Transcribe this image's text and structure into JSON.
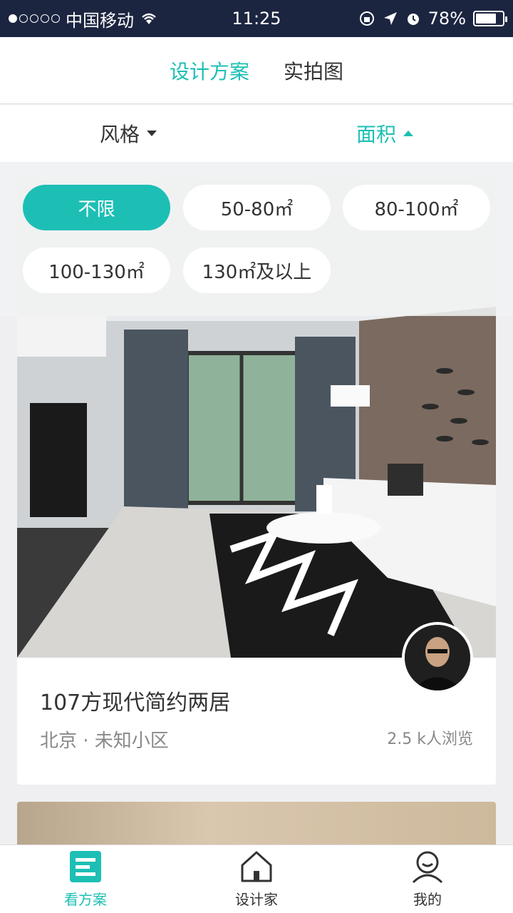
{
  "statusbar": {
    "carrier": "中国移动",
    "time": "11:25",
    "battery": "78%",
    "battery_level": 0.78
  },
  "tabs": [
    {
      "label": "设计方案",
      "active": true
    },
    {
      "label": "实拍图",
      "active": false
    }
  ],
  "filters": {
    "style": "风格",
    "area": "面积"
  },
  "area_options": [
    {
      "label": "不限",
      "active": true
    },
    {
      "label": "50-80㎡",
      "active": false
    },
    {
      "label": "80-100㎡",
      "active": false
    },
    {
      "label": "100-130㎡",
      "active": false
    },
    {
      "label": "130㎡及以上",
      "active": false
    }
  ],
  "card": {
    "title": "107方现代简约两居",
    "location": "北京 · 未知小区",
    "views": "2.5 k人浏览"
  },
  "bottom_nav": [
    {
      "label": "看方案",
      "icon": "plan-icon",
      "active": true
    },
    {
      "label": "设计家",
      "icon": "house-icon",
      "active": false
    },
    {
      "label": "我的",
      "icon": "user-icon",
      "active": false
    }
  ],
  "colors": {
    "accent": "#1dbfb5",
    "statusbar": "#1c2540"
  }
}
